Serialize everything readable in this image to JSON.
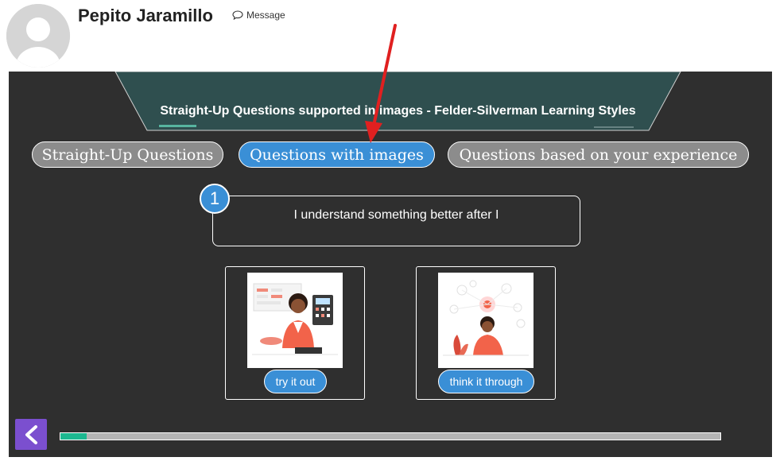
{
  "profile": {
    "name": "Pepito Jaramillo",
    "message_label": "Message"
  },
  "quiz": {
    "title": "Straight-Up Questions supported in images - Felder-Silverman Learning Styles",
    "tabs": [
      {
        "label": "Straight-Up Questions",
        "active": false
      },
      {
        "label": "Questions with images",
        "active": true
      },
      {
        "label": "Questions based on your experience",
        "active": false
      }
    ],
    "question": {
      "number": "1",
      "text": "I understand something better after I"
    },
    "options": [
      {
        "label": "try it out",
        "icon": "illustration-woman-calculator"
      },
      {
        "label": "think it through",
        "icon": "illustration-man-thinking"
      }
    ],
    "progress": 0.04
  },
  "colors": {
    "panel_bg": "#2f2f2f",
    "banner_bg": "#2f4f4f",
    "accent_blue": "#3a8fd6",
    "tab_grey": "#8c8c8c",
    "progress_fill": "#1cb890",
    "back_purple": "#7b4fcf",
    "annotation_red": "#e02020"
  }
}
